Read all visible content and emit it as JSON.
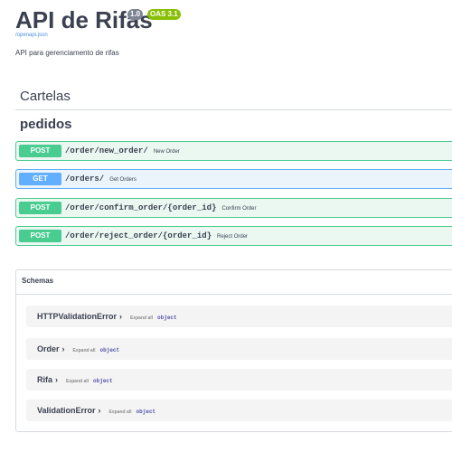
{
  "info": {
    "title": "API de Rifas",
    "version": "1.0",
    "oas": "OAS 3.1",
    "spec_link": "/openapi.json",
    "description": "API para gerenciamento de rifas"
  },
  "tags": [
    {
      "name": "Cartelas"
    },
    {
      "name": "pedidos"
    }
  ],
  "operations": [
    {
      "method": "POST",
      "path": "/order/new_order/",
      "summary": "New Order"
    },
    {
      "method": "GET",
      "path": "/orders/",
      "summary": "Get Orders"
    },
    {
      "method": "POST",
      "path": "/order/confirm_order/{order_id}",
      "summary": "Confirm Order"
    },
    {
      "method": "POST",
      "path": "/order/reject_order/{order_id}",
      "summary": "Reject Order"
    }
  ],
  "schemas": {
    "title": "Schemas",
    "expand_label": "Expand all",
    "models": [
      {
        "name": "HTTPValidationError",
        "type": "object"
      },
      {
        "name": "Order",
        "type": "object"
      },
      {
        "name": "Rifa",
        "type": "object"
      },
      {
        "name": "ValidationError",
        "type": "object"
      }
    ]
  },
  "colors": {
    "post": "#49cc90",
    "get": "#61affe",
    "version_badge": "#7d8492",
    "oas_badge": "#89bf04"
  }
}
